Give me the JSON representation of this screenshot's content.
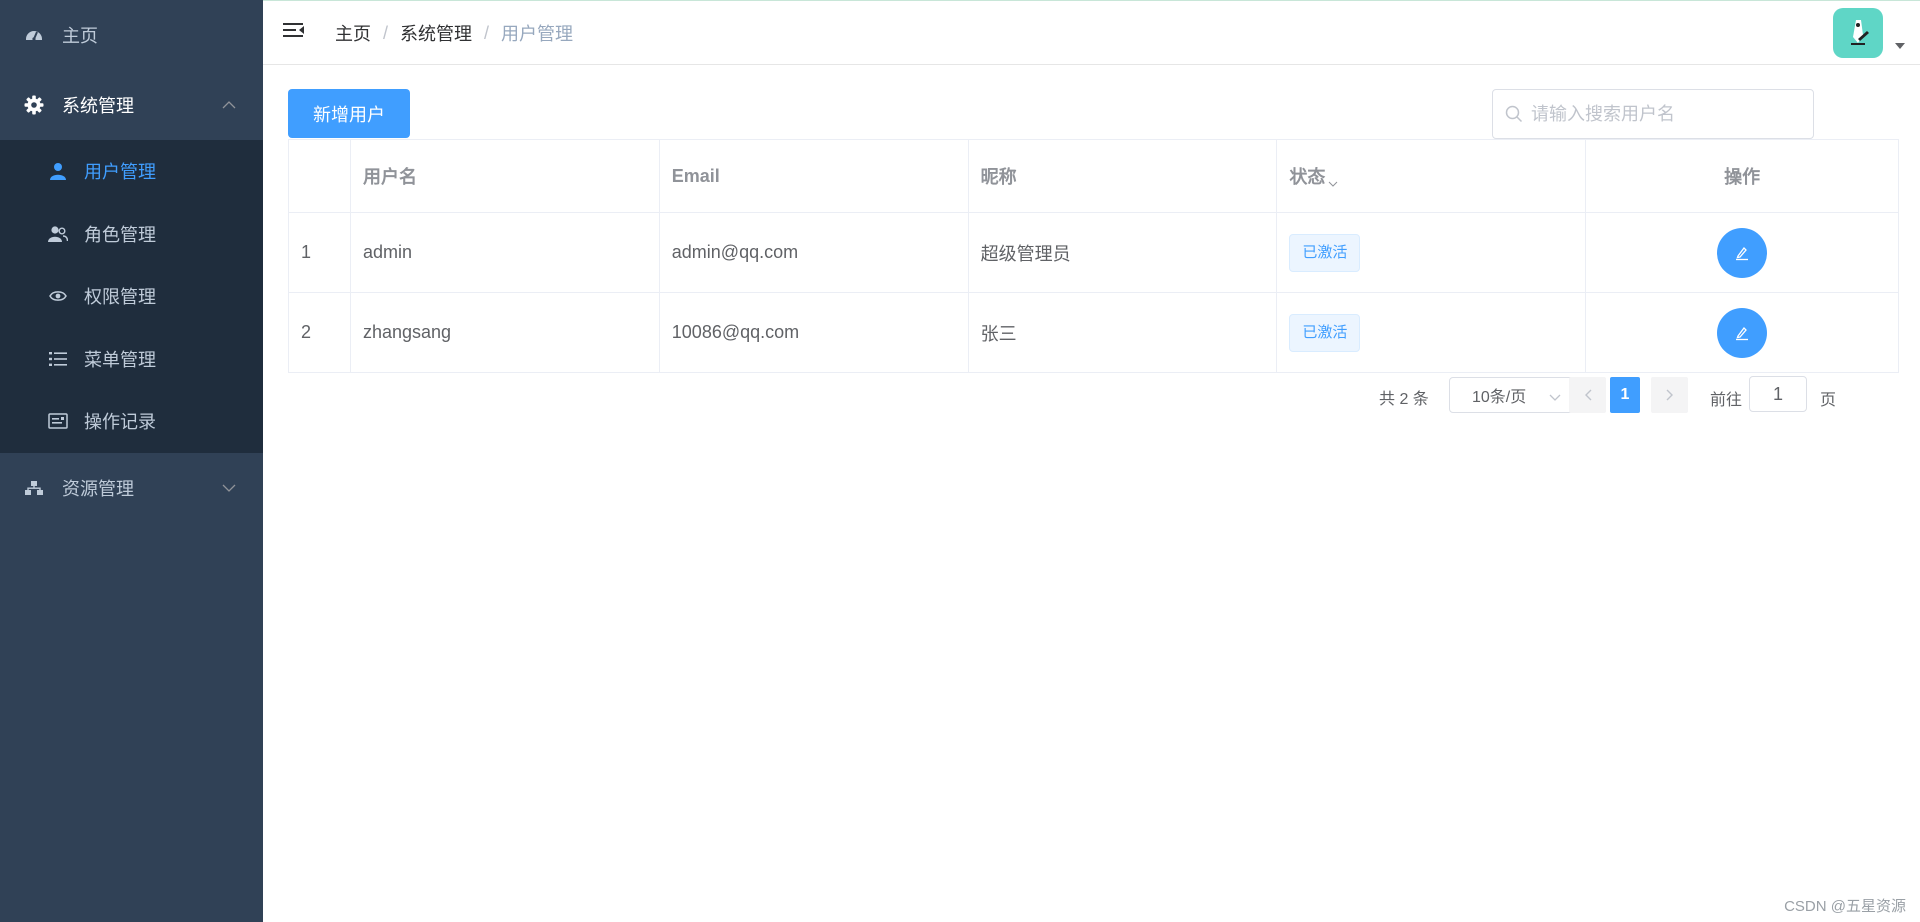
{
  "sidebar": {
    "home": {
      "label": "主页",
      "icon": "dashboard-icon"
    },
    "system": {
      "label": "系统管理",
      "icon": "gear-icon",
      "expanded": true
    },
    "sub_items": [
      {
        "label": "用户管理",
        "icon": "user-icon",
        "active": true
      },
      {
        "label": "角色管理",
        "icon": "users-icon"
      },
      {
        "label": "权限管理",
        "icon": "eye-icon"
      },
      {
        "label": "菜单管理",
        "icon": "list-icon"
      },
      {
        "label": "操作记录",
        "icon": "id-card-icon"
      }
    ],
    "resources": {
      "label": "资源管理",
      "icon": "sitemap-icon",
      "expanded": false
    }
  },
  "breadcrumb": [
    "主页",
    "系统管理",
    "用户管理"
  ],
  "toolbar": {
    "add_label": "新增用户",
    "search_placeholder": "请输入搜索用户名"
  },
  "table": {
    "columns": [
      "",
      "用户名",
      "Email",
      "昵称",
      "状态",
      "操作"
    ],
    "rows": [
      {
        "index": "1",
        "username": "admin",
        "email": "admin@qq.com",
        "nickname": "超级管理员",
        "status": "已激活"
      },
      {
        "index": "2",
        "username": "zhangsang",
        "email": "10086@qq.com",
        "nickname": "张三",
        "status": "已激活"
      }
    ]
  },
  "pagination": {
    "total": "共 2 条",
    "page_size": "10条/页",
    "current_page": "1",
    "goto_label": "前往",
    "goto_value": "1",
    "goto_suffix": "页"
  },
  "watermark": "CSDN @五星资源",
  "colors": {
    "sidebar_bg": "#304156",
    "submenu_bg": "#1f2d3d",
    "primary": "#409eff",
    "avatar_bg": "#5fd6c6"
  }
}
